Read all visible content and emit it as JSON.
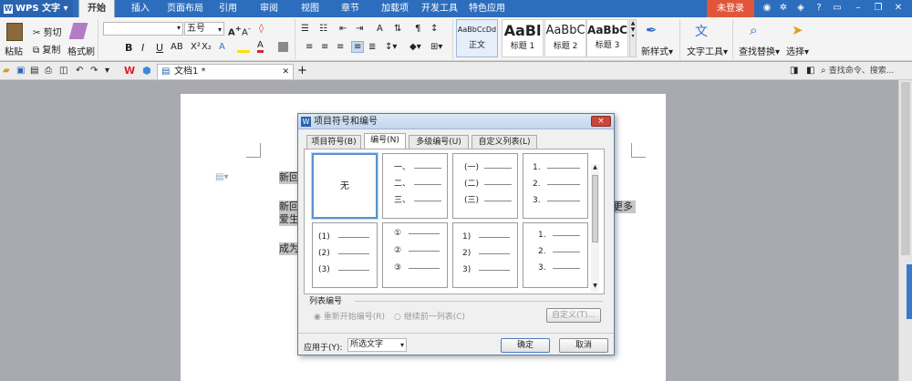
{
  "app": {
    "name": "WPS 文字"
  },
  "menu": [
    "开始",
    "插入",
    "页面布局",
    "引用",
    "审阅",
    "视图",
    "章节",
    "加载项",
    "开发工具",
    "特色应用"
  ],
  "login": "未登录",
  "ribbon": {
    "paste": "粘贴",
    "cut": "剪切",
    "copy": "复制",
    "format_painter": "格式刷",
    "font_size": "五号",
    "bold": "B",
    "italic": "I",
    "underline": "U",
    "styles": [
      {
        "preview": "AaBbCcDd",
        "name": "正文"
      },
      {
        "preview": "AaBl",
        "name": "标题 1"
      },
      {
        "preview": "AaBbC",
        "name": "标题 2"
      },
      {
        "preview": "AaBbC",
        "name": "标题 3"
      }
    ],
    "new_style": "新样式",
    "text_tools": "文字工具",
    "find_replace": "查找替换",
    "select": "选择"
  },
  "quickbar": {
    "doc_tab": "文档1 *",
    "search_placeholder": "查找命令、搜索..."
  },
  "document": {
    "lines": [
      "新回",
      "新回",
      "爱生",
      "成为"
    ],
    "right_fragment": "更多"
  },
  "dialog": {
    "title": "项目符号和编号",
    "close": "×",
    "tabs": [
      "项目符号(B)",
      "编号(N)",
      "多级编号(U)",
      "自定义列表(L)"
    ],
    "none_label": "无",
    "grid": [
      [
        "一、",
        "二、",
        "三、"
      ],
      [
        "(一)",
        "(二)",
        "(三)"
      ],
      [
        "1.",
        "2.",
        "3."
      ],
      [
        "(1)",
        "(2)",
        "(3)"
      ],
      [
        "①",
        "②",
        "③"
      ],
      [
        "1)",
        "2)",
        "3)"
      ],
      [
        "1.",
        "2.",
        "3."
      ]
    ],
    "list_numbering_label": "列表编号",
    "restart": "重新开始编号(R)",
    "continue": "继续前一列表(C)",
    "customize": "自定义(T)...",
    "apply_to_label": "应用于(Y):",
    "apply_to_value": "所选文字",
    "ok": "确定",
    "cancel": "取消"
  }
}
